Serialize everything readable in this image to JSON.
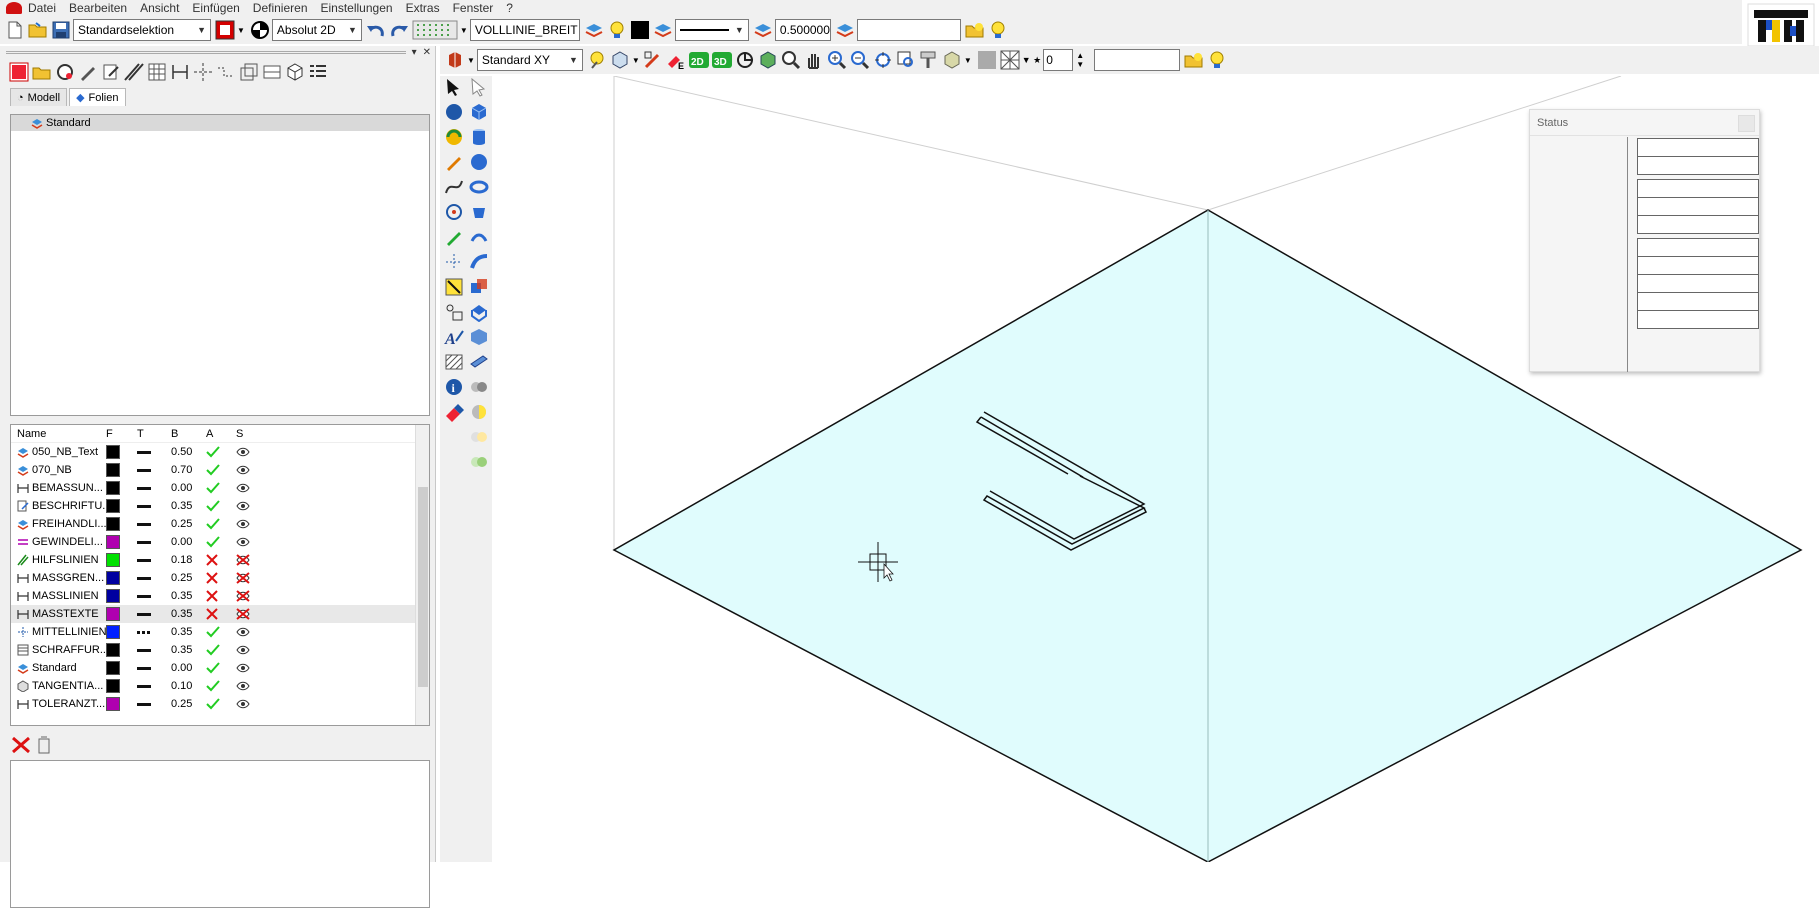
{
  "menu": [
    "Datei",
    "Bearbeiten",
    "Ansicht",
    "Einfügen",
    "Definieren",
    "Einstellungen",
    "Extras",
    "Fenster",
    "?"
  ],
  "toolbar1": {
    "selection_mode": "Standardselektion",
    "coord_mode": "Absolut 2D",
    "line_type": "VOLLLINIE_BREIT",
    "line_width": "0.500000",
    "free_field": "",
    "accent_color": "#d40000"
  },
  "toolbar2": {
    "view_plane": "Standard XY",
    "btn_2d": "2D",
    "btn_3d": "3D",
    "number_value": "0",
    "free_field": ""
  },
  "left_panel": {
    "tabs": [
      {
        "label": "Modell",
        "active": false
      },
      {
        "label": "Folien",
        "active": true
      }
    ],
    "tree": [
      "Standard"
    ],
    "layers_header": {
      "name": "Name",
      "f": "F",
      "t": "T",
      "b": "B",
      "a": "A",
      "s": "S"
    },
    "layers": [
      {
        "name": "050_NB_Text",
        "color": "#000000",
        "line": "solid",
        "width": "0.50",
        "active": true,
        "visible": true,
        "icon": "layer-icon",
        "selected": false
      },
      {
        "name": "070_NB",
        "color": "#000000",
        "line": "solid",
        "width": "0.70",
        "active": true,
        "visible": true,
        "icon": "layer-icon",
        "selected": false
      },
      {
        "name": "BEMASSUN...",
        "color": "#000000",
        "line": "solid",
        "width": "0.00",
        "active": true,
        "visible": true,
        "icon": "dimension-layer-icon",
        "selected": false
      },
      {
        "name": "BESCHRIFTU...",
        "color": "#000000",
        "line": "solid",
        "width": "0.35",
        "active": true,
        "visible": true,
        "icon": "label-layer-icon",
        "selected": false
      },
      {
        "name": "FREIHANDLI...",
        "color": "#000000",
        "line": "solid",
        "width": "0.25",
        "active": true,
        "visible": true,
        "icon": "layer-icon",
        "selected": false
      },
      {
        "name": "GEWINDELI...",
        "color": "#b000b0",
        "line": "solid",
        "width": "0.00",
        "active": true,
        "visible": true,
        "icon": "thread-layer-icon",
        "selected": false
      },
      {
        "name": "HILFSLINIEN",
        "color": "#00e000",
        "line": "solid",
        "width": "0.18",
        "active": false,
        "visible": false,
        "icon": "helpline-layer-icon",
        "selected": false
      },
      {
        "name": "MASSGREN...",
        "color": "#0000a0",
        "line": "solid",
        "width": "0.25",
        "active": false,
        "visible": false,
        "icon": "dimension-layer-icon",
        "selected": false
      },
      {
        "name": "MASSLINIEN",
        "color": "#0000a0",
        "line": "solid",
        "width": "0.35",
        "active": false,
        "visible": false,
        "icon": "dimension-layer-icon",
        "selected": false
      },
      {
        "name": "MASSTEXTE",
        "color": "#b000b0",
        "line": "solid",
        "width": "0.35",
        "active": false,
        "visible": false,
        "icon": "dimension-layer-icon",
        "selected": true
      },
      {
        "name": "MITTELLINIEN",
        "color": "#0020ff",
        "line": "dash",
        "width": "0.35",
        "active": true,
        "visible": true,
        "icon": "centerline-layer-icon",
        "selected": false
      },
      {
        "name": "SCHRAFFUR...",
        "color": "#000000",
        "line": "solid",
        "width": "0.35",
        "active": true,
        "visible": true,
        "icon": "hatch-layer-icon",
        "selected": false
      },
      {
        "name": "Standard",
        "color": "#000000",
        "line": "solid",
        "width": "0.00",
        "active": true,
        "visible": true,
        "icon": "layer-icon",
        "selected": false
      },
      {
        "name": "TANGENTIA...",
        "color": "#000000",
        "line": "solid",
        "width": "0.10",
        "active": true,
        "visible": true,
        "icon": "tangent-layer-icon",
        "selected": false
      },
      {
        "name": "TOLERANZT...",
        "color": "#b000b0",
        "line": "solid",
        "width": "0.25",
        "active": true,
        "visible": true,
        "icon": "dimension-layer-icon",
        "selected": false
      }
    ]
  },
  "status_panel": {
    "title": "Status",
    "field_count": 10
  },
  "colors": {
    "plane_fill": "#e0fcfd",
    "check_green": "#22cc22",
    "cross_red": "#dd1111"
  }
}
